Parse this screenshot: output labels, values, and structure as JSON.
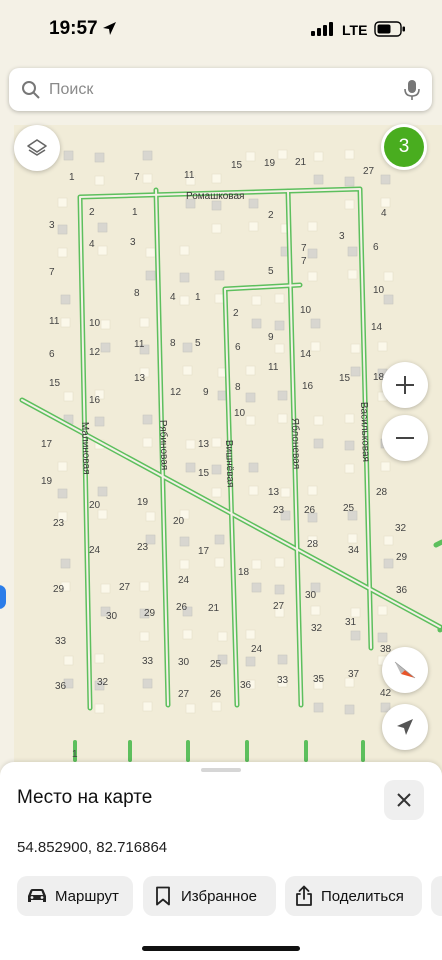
{
  "status_bar": {
    "time": "19:57",
    "network": "LTE",
    "icons": [
      "location-arrow-icon",
      "signal-bars-icon",
      "battery-icon"
    ]
  },
  "search": {
    "placeholder": "Поиск",
    "icons": [
      "search-icon",
      "microphone-icon"
    ]
  },
  "map": {
    "layers_icon": "layers-icon",
    "notification_count": "3",
    "accent_color": "#49ad1f",
    "road_color": "#5dbf5d",
    "streets": [
      "Ромашковая",
      "Малиновая",
      "Рябиновая",
      "Вишнёвая",
      "Яблоневая",
      "Васильковая"
    ],
    "house_numbers": [
      "1",
      "7",
      "11",
      "15",
      "19",
      "21",
      "27",
      "2",
      "1",
      "3",
      "2",
      "4",
      "6",
      "4",
      "3",
      "7",
      "3",
      "7",
      "8",
      "7",
      "4",
      "1",
      "5",
      "6",
      "10",
      "2",
      "10",
      "11",
      "10",
      "11",
      "9",
      "14",
      "8",
      "5",
      "6",
      "13",
      "12",
      "11",
      "15",
      "16",
      "18",
      "15",
      "13",
      "12",
      "9",
      "8",
      "16",
      "17",
      "10",
      "14",
      "13",
      "15",
      "19",
      "20",
      "19",
      "20",
      "23",
      "23",
      "26",
      "25",
      "28",
      "32",
      "24",
      "23",
      "17",
      "18",
      "29",
      "34",
      "29",
      "27",
      "24",
      "28",
      "30",
      "36",
      "30",
      "29",
      "26",
      "21",
      "27",
      "31",
      "33",
      "32",
      "38",
      "33",
      "30",
      "25",
      "24",
      "33",
      "35",
      "37",
      "36",
      "32",
      "27",
      "26",
      "36",
      "42",
      "1"
    ],
    "zoom_in_icon": "plus-icon",
    "zoom_out_icon": "minus-icon",
    "compass_icon": "compass-icon",
    "locate_icon": "navigation-arrow-icon"
  },
  "sheet": {
    "title": "Место на карте",
    "coords": "54.852900, 82.716864",
    "close_icon": "close-icon",
    "actions": [
      {
        "label": "Маршрут",
        "icon": "car-icon"
      },
      {
        "label": "Избранное",
        "icon": "bookmark-icon"
      },
      {
        "label": "Поделиться",
        "icon": "share-icon"
      }
    ]
  }
}
